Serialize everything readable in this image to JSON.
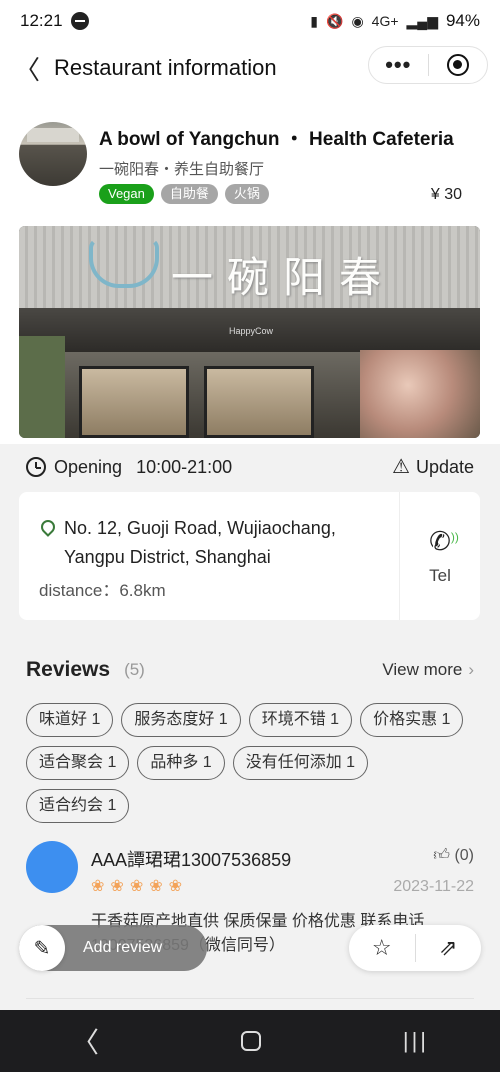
{
  "status_bar": {
    "time": "12:21",
    "network": "4G+",
    "battery": "94%"
  },
  "nav": {
    "title": "Restaurant information"
  },
  "restaurant": {
    "name": "A bowl of Yangchun ・ Health Cafeteria",
    "subname": "一碗阳春・养生自助餐厅",
    "tags": [
      "Vegan",
      "自助餐",
      "火锅"
    ],
    "price": "¥ 30",
    "banner_sign": "一碗阳春",
    "banner_watermark": "HappyCow"
  },
  "hours": {
    "label": "Opening",
    "value": "10:00-21:00",
    "update_label": "Update"
  },
  "address": {
    "text": "No. 12, Guoji Road, Wujiaochang, Yangpu District, Shanghai",
    "distance": "distance：6.8km",
    "tel_label": "Tel"
  },
  "reviews": {
    "title": "Reviews",
    "count": "(5)",
    "view_more": "View more",
    "chips": [
      "味道好 1",
      "服务态度好 1",
      "环境不错 1",
      "价格实惠 1",
      "适合聚会 1",
      "品种多 1",
      "没有任何添加 1",
      "适合约会 1"
    ],
    "items": [
      {
        "user": "AAA譚珺珺13007536859",
        "likes": "(0)",
        "rating": 5,
        "date": "2023-11-22",
        "text": "干香菇原产地直供 保质保量 价格优惠 联系电话 13007536859（微信同号）"
      }
    ]
  },
  "actions": {
    "add_review": "Add review"
  },
  "colors": {
    "vegan_tag": "#1aa01a",
    "avatar": "#3d8ff0",
    "star": "#f3a35a"
  }
}
